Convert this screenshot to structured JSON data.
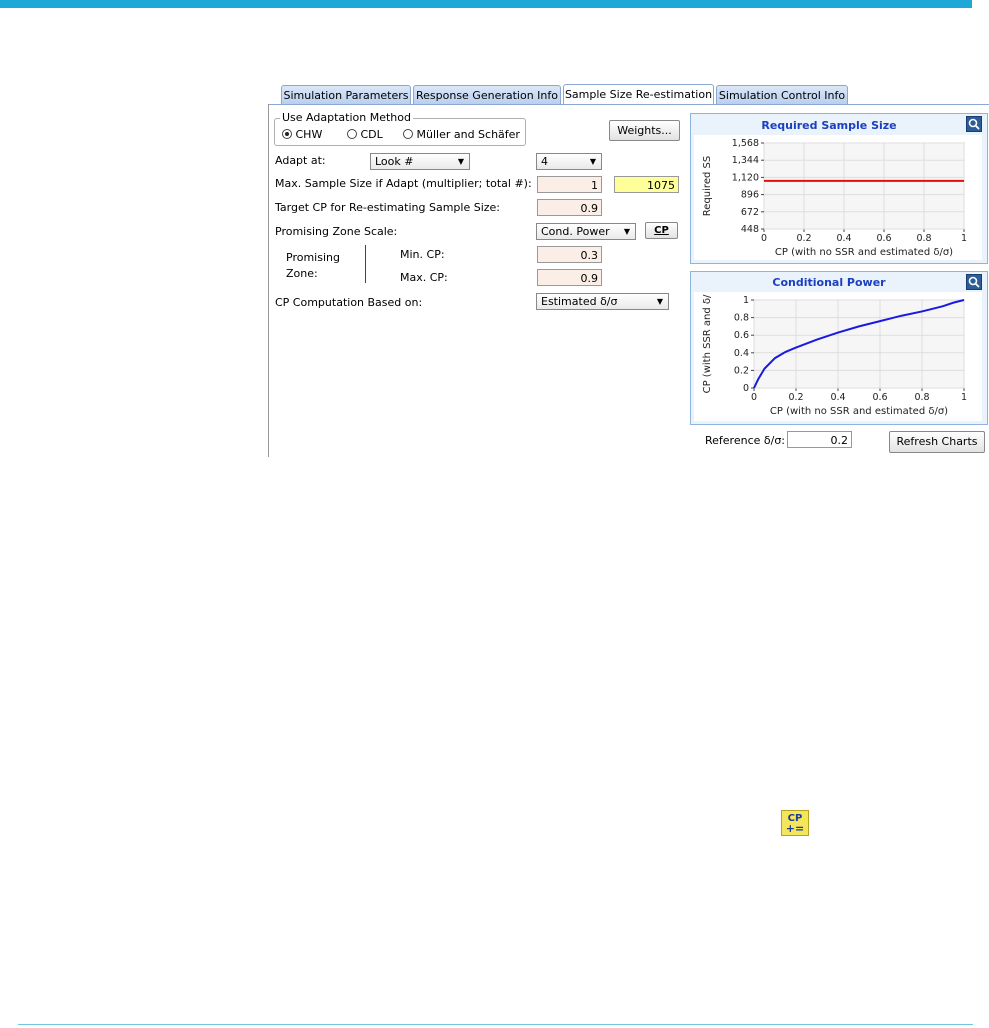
{
  "tabs": [
    {
      "label": "Simulation Parameters"
    },
    {
      "label": "Response Generation Info"
    },
    {
      "label": "Sample Size Re-estimation"
    },
    {
      "label": "Simulation Control Info"
    }
  ],
  "adaptation": {
    "legend": "Use Adaptation Method",
    "options": [
      "CHW",
      "CDL",
      "Müller and Schäfer"
    ],
    "selected": "CHW",
    "weights_button": "Weights..."
  },
  "form": {
    "adapt_at_label": "Adapt at:",
    "adapt_at_value": "Look #",
    "look_value": "4",
    "max_ss_label": "Max. Sample Size if Adapt (multiplier; total #):",
    "max_ss_multiplier": "1",
    "max_ss_total": "1075",
    "target_cp_label": "Target CP for Re-estimating Sample Size:",
    "target_cp_value": "0.9",
    "pz_scale_label": "Promising Zone Scale:",
    "pz_scale_value": "Cond. Power",
    "cp_button": "CP",
    "pz_label_1": "Promising",
    "pz_label_2": "Zone:",
    "min_cp_label": "Min. CP:",
    "min_cp_value": "0.3",
    "max_cp_label": "Max. CP:",
    "max_cp_value": "0.9",
    "cp_based_label": "CP Computation Based on:",
    "cp_based_value": "Estimated δ/σ"
  },
  "charts": {
    "reference_label": "Reference δ/σ:",
    "reference_value": "0.2",
    "refresh_button": "Refresh Charts"
  },
  "icon_cp": {
    "top": "CP",
    "bottom": "+="
  },
  "chart_data": [
    {
      "type": "line",
      "title": "Required Sample Size",
      "xlabel": "CP (with no SSR and estimated δ/σ)",
      "ylabel": "Required SS",
      "xlim": [
        0,
        1
      ],
      "ylim": [
        448,
        1568
      ],
      "xticks": [
        "0",
        "0.2",
        "0.4",
        "0.6",
        "0.8",
        "1"
      ],
      "yticks": [
        "1,568",
        "1,344",
        "1,120",
        "896",
        "672",
        "448"
      ],
      "series": [
        {
          "color": "#e01010",
          "x": [
            0,
            0.25,
            0.5,
            0.75,
            1
          ],
          "y": [
            1075,
            1075,
            1075,
            1075,
            1075
          ]
        }
      ],
      "grid": true
    },
    {
      "type": "line",
      "title": "Conditional Power",
      "xlabel": "CP (with no SSR and estimated δ/σ)",
      "ylabel": "CP (with SSR and δ/",
      "xlim": [
        0,
        1
      ],
      "ylim": [
        0,
        1
      ],
      "xticks": [
        "0",
        "0.2",
        "0.4",
        "0.6",
        "0.8",
        "1"
      ],
      "yticks": [
        "1",
        "0.8",
        "0.6",
        "0.4",
        "0.2",
        "0"
      ],
      "series": [
        {
          "color": "#1a1ae0",
          "x": [
            0,
            0.02,
            0.05,
            0.1,
            0.15,
            0.2,
            0.3,
            0.4,
            0.5,
            0.6,
            0.7,
            0.8,
            0.9,
            0.95,
            1
          ],
          "y": [
            0,
            0.1,
            0.22,
            0.34,
            0.41,
            0.46,
            0.55,
            0.63,
            0.7,
            0.76,
            0.82,
            0.87,
            0.93,
            0.97,
            1
          ]
        }
      ],
      "grid": true
    }
  ]
}
